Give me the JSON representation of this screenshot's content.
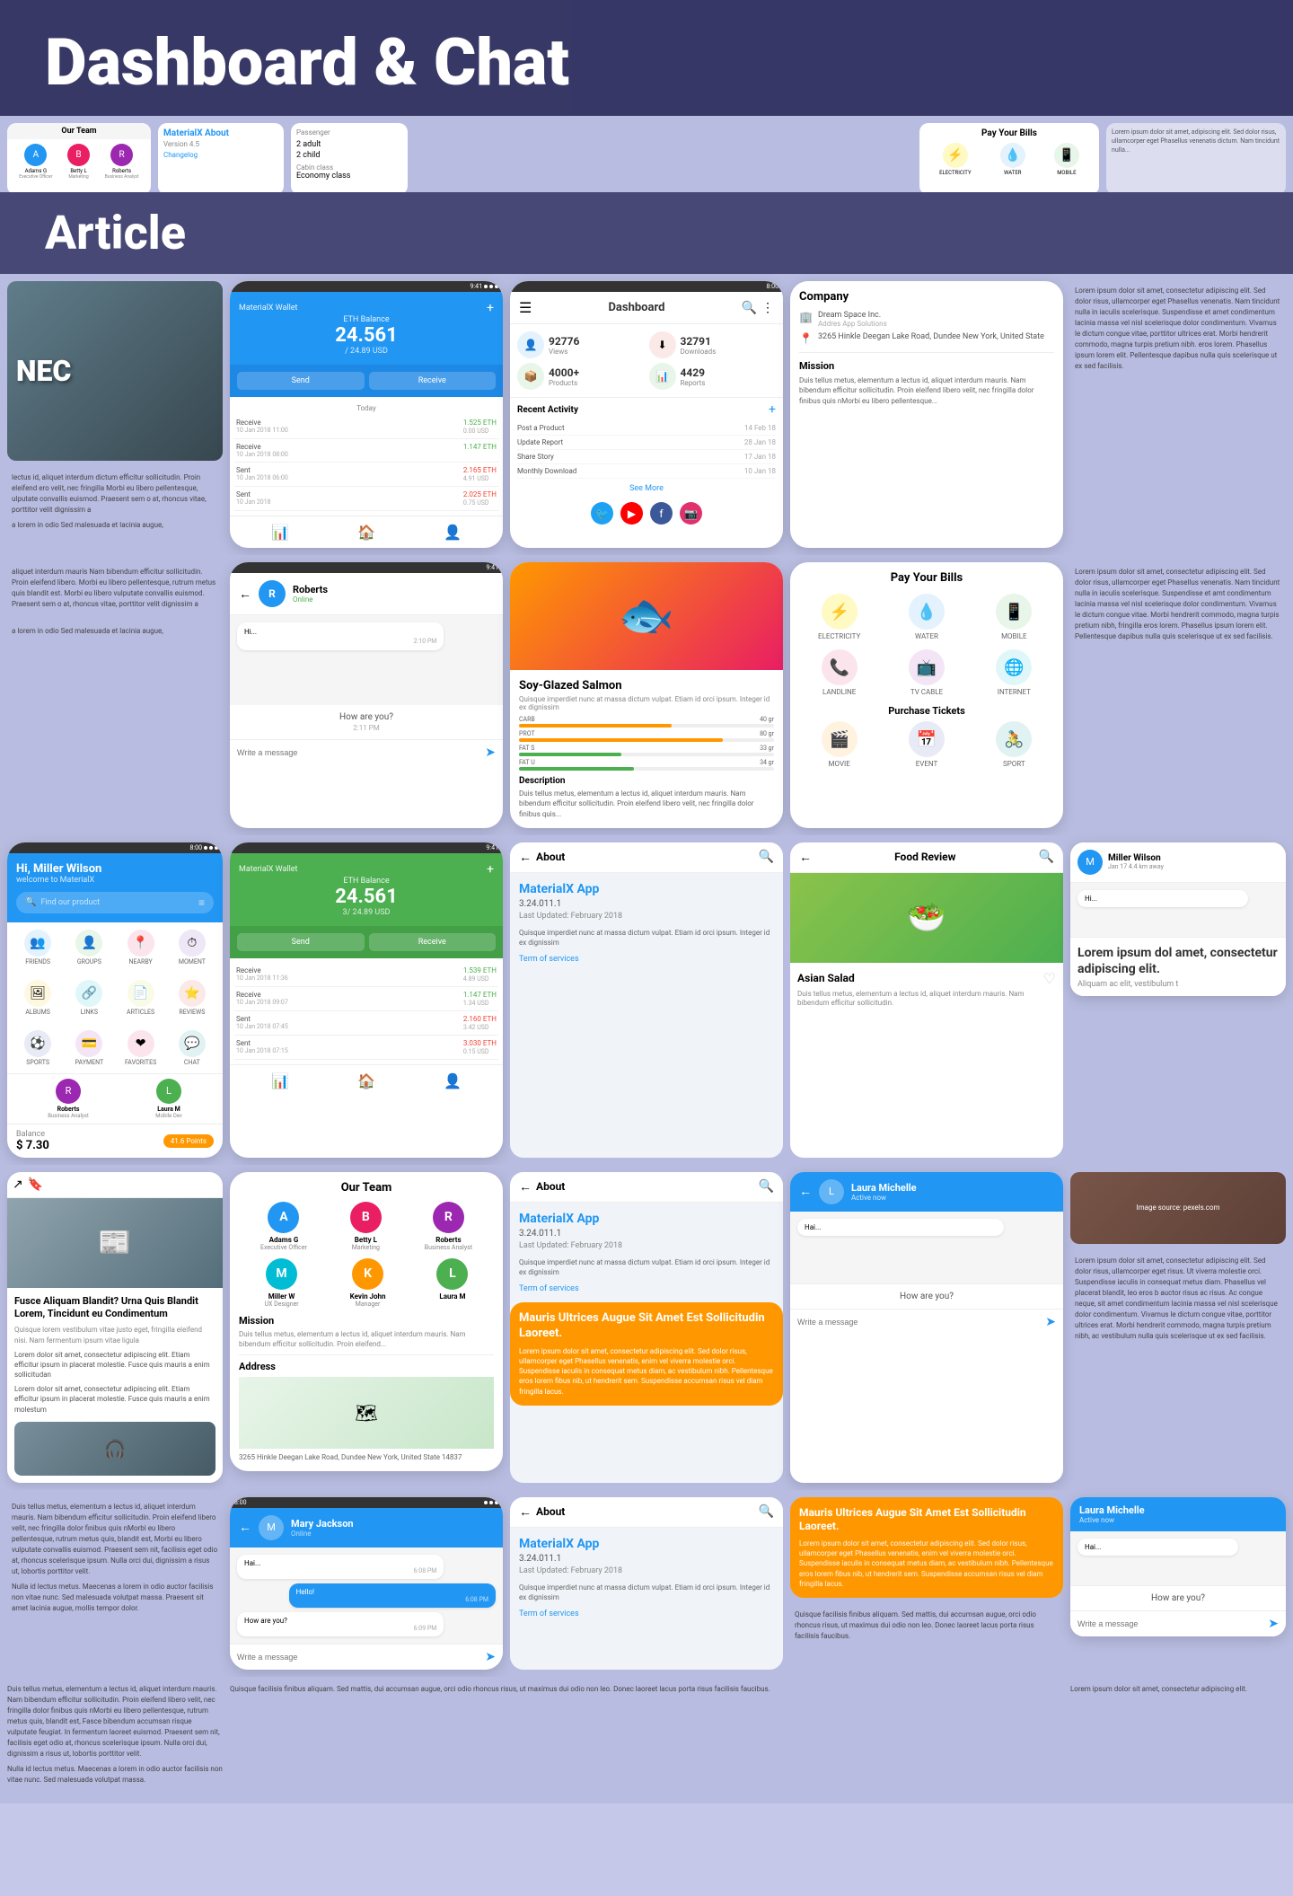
{
  "header": {
    "title": "Dashboard & Chat",
    "subtitle": "Article"
  },
  "wallet": {
    "title": "MaterialX Wallet",
    "balance_label": "ETH Balance",
    "balance_amount": "24.561",
    "balance_usd": "/ 24.89 USD",
    "send_label": "Send",
    "receive_label": "Receive",
    "today_label": "Today",
    "transactions": [
      {
        "type": "Receive",
        "date": "10 Jan 2018 11:00",
        "amount": "1.525 ETH",
        "usd": "0.00 USD",
        "color": "green"
      },
      {
        "type": "Receive",
        "date": "10 Jan 2018 08:00",
        "amount": "1.147 ETH",
        "usd": "",
        "color": "green"
      },
      {
        "type": "Sent",
        "date": "10 Jan 2018 06:00",
        "amount": "2.165 ETH",
        "usd": "4.91 USD",
        "color": "red"
      },
      {
        "type": "Sent",
        "date": "10 Jan 2018",
        "amount": "2.025 ETH",
        "usd": "0.75 USD",
        "color": "red"
      }
    ]
  },
  "wallet_green": {
    "title": "MaterialX Wallet",
    "balance_label": "ETH Balance",
    "balance_amount": "24.561",
    "balance_usd": "3/ 24.89 USD",
    "send_label": "Send",
    "receive_label": "Receive",
    "transactions": [
      {
        "type": "Receive",
        "date": "10 Jan 2018 11:36",
        "amount": "1.539 ETH",
        "usd": "4.89 USD",
        "color": "green"
      },
      {
        "type": "Receive",
        "date": "10 Jan 2018 09:07",
        "amount": "1.147 ETH",
        "usd": "1.34 USD",
        "color": "green"
      },
      {
        "type": "Sent",
        "date": "10 Jan 2018 07:45",
        "amount": "2.160 ETH",
        "usd": "3.42 USD",
        "color": "red"
      },
      {
        "type": "Sent",
        "date": "10 Jan 2018 07:15",
        "amount": "3.030 ETH",
        "usd": "0.15 USD",
        "color": "red"
      }
    ]
  },
  "dashboard": {
    "title": "Dashboard",
    "stats": [
      {
        "value": "92776",
        "label": "Views",
        "color": "#2196F3",
        "icon": "👤"
      },
      {
        "value": "32791",
        "label": "Downloads",
        "color": "#FF5722",
        "icon": "⬇"
      },
      {
        "value": "4000+",
        "label": "Products",
        "color": "#4CAF50",
        "icon": "📦"
      },
      {
        "value": "4429",
        "label": "Reports",
        "color": "#4CAF50",
        "icon": "📊"
      }
    ],
    "recent_activity_label": "Recent Activity",
    "activities": [
      {
        "name": "Post a Product",
        "date": "14 Feb 18"
      },
      {
        "name": "Update Report",
        "date": "28 Jan 18"
      },
      {
        "name": "Share Story",
        "date": "17 Jan 18"
      },
      {
        "name": "Monthly Download",
        "date": "10 Jan 18"
      }
    ],
    "see_more_label": "See More",
    "social_icons": [
      "twitter",
      "youtube",
      "facebook",
      "instagram"
    ]
  },
  "bills": {
    "title": "Pay Your Bills",
    "items_row1": [
      {
        "label": "ELECTRICITY",
        "icon": "⚡",
        "color": "#FFF9C4"
      },
      {
        "label": "WATER",
        "icon": "💧",
        "color": "#E3F2FD"
      },
      {
        "label": "MOBILE",
        "icon": "📱",
        "color": "#E8F5E9"
      }
    ],
    "items_row2": [
      {
        "label": "LANDLINE",
        "icon": "📞",
        "color": "#FCE4EC"
      },
      {
        "label": "TV CABLE",
        "icon": "📺",
        "color": "#F3E5F5"
      },
      {
        "label": "INTERNET",
        "icon": "🌐",
        "color": "#E0F7FA"
      }
    ],
    "purchase_title": "Purchase Tickets",
    "tickets": [
      {
        "label": "MOVIE",
        "icon": "🎬",
        "color": "#FFF3E0"
      },
      {
        "label": "EVENT",
        "icon": "📅",
        "color": "#E8EAF6"
      },
      {
        "label": "SPORT",
        "icon": "🚴",
        "color": "#E0F2F1"
      }
    ]
  },
  "food": {
    "name": "Soy-Glazed Salmon",
    "description": "Quisque imperdiet nunc at massa dictum vulpat. Etiam id orci ipsum. Integer id ex dignissim",
    "nutrition": [
      {
        "label": "CARB",
        "value": "40 gr",
        "pct": 60,
        "color": "#FF9800"
      },
      {
        "label": "PROT",
        "value": "80 gr",
        "pct": 80,
        "color": "#FF9800"
      },
      {
        "label": "FAT S",
        "value": "33 gr",
        "pct": 40,
        "color": "#4CAF50"
      },
      {
        "label": "FAT U",
        "value": "34 gr",
        "pct": 45,
        "color": "#4CAF50"
      }
    ],
    "description_label": "Description",
    "long_desc": "Duis tellus metus, elementum a lectus id, aliquet interdum mauris. Nam bibendum efficitur sollicitudin. Proin eleifend libero velit, nec fringilla dolor finibus quis nMorbi eu libero pellentesque..."
  },
  "chat_roberts": {
    "name": "Roberts",
    "status": "Online",
    "messages": [
      {
        "text": "Hi...",
        "sent": false,
        "time": "2:10 PM"
      },
      {
        "text": "How are you?",
        "sent": true,
        "time": "2:11 PM"
      }
    ],
    "write_message": "Write a message"
  },
  "chat_miller": {
    "name": "Miller Wilson",
    "subtitle": "Jan 17 4.4 km away",
    "lorem_title": "Lorem ipsum dol amet, consectetur adipiscing elit.",
    "lorem_sub": "Aliquam ac elit, vestibulum t"
  },
  "company": {
    "title": "Company",
    "name": "Dream Space Inc.",
    "sub_name": "Addres App Solutions",
    "address": "3265 Hinkle Deegan Lake Road, Dundee New York, United State"
  },
  "about": {
    "back_label": "About",
    "app_name": "MaterialX App",
    "version": "3.24.011.1",
    "last_updated_label": "Last Updated",
    "date": "February 2018",
    "description": "Quisque imperdiet nunc at massa dictum vulpat. Etiam id orci ipsum. Integer id ex dignissim",
    "term_of_services": "Term of services"
  },
  "team": {
    "title": "Our Team",
    "members_row1": [
      {
        "name": "Adams G",
        "role": "Executive Officer",
        "color": "#2196F3",
        "initial": "A"
      },
      {
        "name": "Betty L",
        "role": "Marketing",
        "color": "#E91E63",
        "initial": "B"
      },
      {
        "name": "Roberts",
        "role": "Business Analyst",
        "color": "#9C27B0",
        "initial": "R"
      }
    ],
    "members_row2": [
      {
        "name": "Miller W",
        "role": "UX Designer",
        "color": "#00BCD4",
        "initial": "M"
      },
      {
        "name": "Kevin John",
        "role": "Manager",
        "color": "#FF9800",
        "initial": "K"
      },
      {
        "name": "Laura M",
        "role": "",
        "color": "#4CAF50",
        "initial": "L"
      }
    ]
  },
  "hi_user": {
    "greeting": "Hi, Miller Wilson",
    "sub": "welcome to MaterialX",
    "search_placeholder": "Find our product",
    "categories_row1": [
      {
        "label": "FRIENDS",
        "icon": "👥",
        "color": "#E3F2FD"
      },
      {
        "label": "GROUPS",
        "icon": "👤",
        "color": "#E8F5E9"
      },
      {
        "label": "NEARBY",
        "icon": "📍",
        "color": "#FCE4EC"
      },
      {
        "label": "MOMENT",
        "icon": "⏱",
        "color": "#EDE7F6"
      }
    ],
    "categories_row2": [
      {
        "label": "ALBUMS",
        "icon": "🖼",
        "color": "#FFF8E1"
      },
      {
        "label": "LINKS",
        "icon": "🔗",
        "color": "#E0F7FA"
      },
      {
        "label": "ARTICLES",
        "icon": "📄",
        "color": "#F9FBE7"
      },
      {
        "label": "REVIEWS",
        "icon": "⭐",
        "color": "#FBE9E7"
      }
    ],
    "categories_row3": [
      {
        "label": "SPORTS",
        "icon": "⚽",
        "color": "#E8EAF6"
      },
      {
        "label": "PAYMENT",
        "icon": "💳",
        "color": "#F3E5F5"
      },
      {
        "label": "FAVORITES",
        "icon": "❤",
        "color": "#FCE4EC"
      },
      {
        "label": "CHAT",
        "icon": "💬",
        "color": "#E0F2F1"
      }
    ],
    "balance": "$ 7.30",
    "points": "41.6 Points",
    "user_name": "Roberts",
    "user_role": "Business Analyst",
    "user2_name": "Laura M",
    "user2_role": "Mobile Dev"
  },
  "article_blog": {
    "title": "Fusce Aliquam Blandit? Urna Quis Blandit Lorem, Tincidunt eu Condimentum",
    "excerpt": "Quisque lorem vestibulum vitae justo eget, fringilla eleifend nisi. Nam fermentum ipsum vitae ligula",
    "paragraphs": [
      "Lorem dolor sit amet, consectetur adipiscing elit. Etiam efficitur ipsum in placerat molestie. Fusce quis mauris a enim sollicitudan",
      "Lorem dolor sit amet, consectetur adipiscing elit. Etiam efficitur ipsum in placerat molestie. Fusce quis mauris a enim molestum"
    ]
  },
  "food_review": {
    "title": "Food Review",
    "dish_name": "Asian Salad",
    "description": "Duis tellus metus, elementum a lectus id, aliquet interdum mauris. Nam bibendum efficitur sollicitudin.",
    "heart_icon": "♡"
  },
  "mary_jackson": {
    "name": "Mary Jackson",
    "status": "Online",
    "messages": [
      {
        "text": "Hai...",
        "sent": false,
        "time": "6:08 PM"
      },
      {
        "text": "Hello!",
        "sent": true,
        "time": "6:08 PM"
      },
      {
        "text": "How are you?",
        "sent": false,
        "time": "6:09 PM"
      }
    ]
  },
  "laura_michelle": {
    "name": "Laura Michelle",
    "status": "Active now",
    "messages": [
      {
        "text": "Hai...",
        "sent": false,
        "time": ""
      }
    ],
    "how_are_you": "How are you?"
  },
  "maure_article": {
    "title": "Mauris Ultrices Augue Sit Amet Est Sollicitudin Laoreet.",
    "content": "Lorem ipsum dolor sit amet, consectetur adipiscing elit. Sed dolor risus, ullamcorper eget Phasellus venenatis, enim vel viverra molestie orci. Suspendisse iaculis in consequat metus diam, ac vestibulum nibh. Pellentesque eros lorem fibus nib, ut hendrerit sem. Suspendisse accumsan risus vel diam fringilla lacus."
  },
  "address": {
    "title": "Address",
    "address_text": "3265 Hinkle Deegan Lake Road, Dundee New York, United State 14837"
  },
  "sidebar_lorem": {
    "text1": "Lorem ipsum dolor sit amet, consectetur adipiscing elit. Sed dolor risus, ullamcorper eget Phasellus venenatis, enim vel viverra molestie orci. Suspendisse lacus scelerisque sed. Phasellus vel placerat blandit, leo eros bibendum, auctor mauris diam ac risus congue risque et sit amet condimentum lacinia massa vel nisl scelerisque dolor condimentum. Vivamus le dictum congue vitae, porttitor ultrices erat. Morbi hendrerit commodo, magna turpis pretium nibh, fringilla eros lorem. Phasellus ipsum lorem elit.",
    "text2": "Pellentesque dapibus nulla quis scelerisque ut ex sed facilisis."
  },
  "right_lorem": {
    "text": "Lorem ipsum dolor sit amet, consectetur adipiscing elit. Sed dolor risus, ullamcorper eget Phasellus venenatis, enim vel viverra molestie orci. Nam tincidunt nulla in iaculis scelerisque. Suspendisse et tincidunt eros. Fusce scelerisque sed. Phasellus vel placerat blandit, leo eros bibendum, auctor mauris diam ac risus congue risque et sit amet condimentum lacinia massa vel nisl scelerisque dolor condimentum. Vivamus le dictum congue vitae, porttitor ultrices erat. Morbi hendrerit commodo, magna turpis pretium nibh. Prae: Phasellus ipsum lorem elit. Pellentesque dapibus nulla quis scelerisque ut ex sed facilisis."
  },
  "colors": {
    "accent_blue": "#2196F3",
    "accent_green": "#4CAF50",
    "accent_orange": "#FF9800",
    "background": "#b8bce0",
    "header_dark": "rgba(30,30,80,0.85)"
  }
}
